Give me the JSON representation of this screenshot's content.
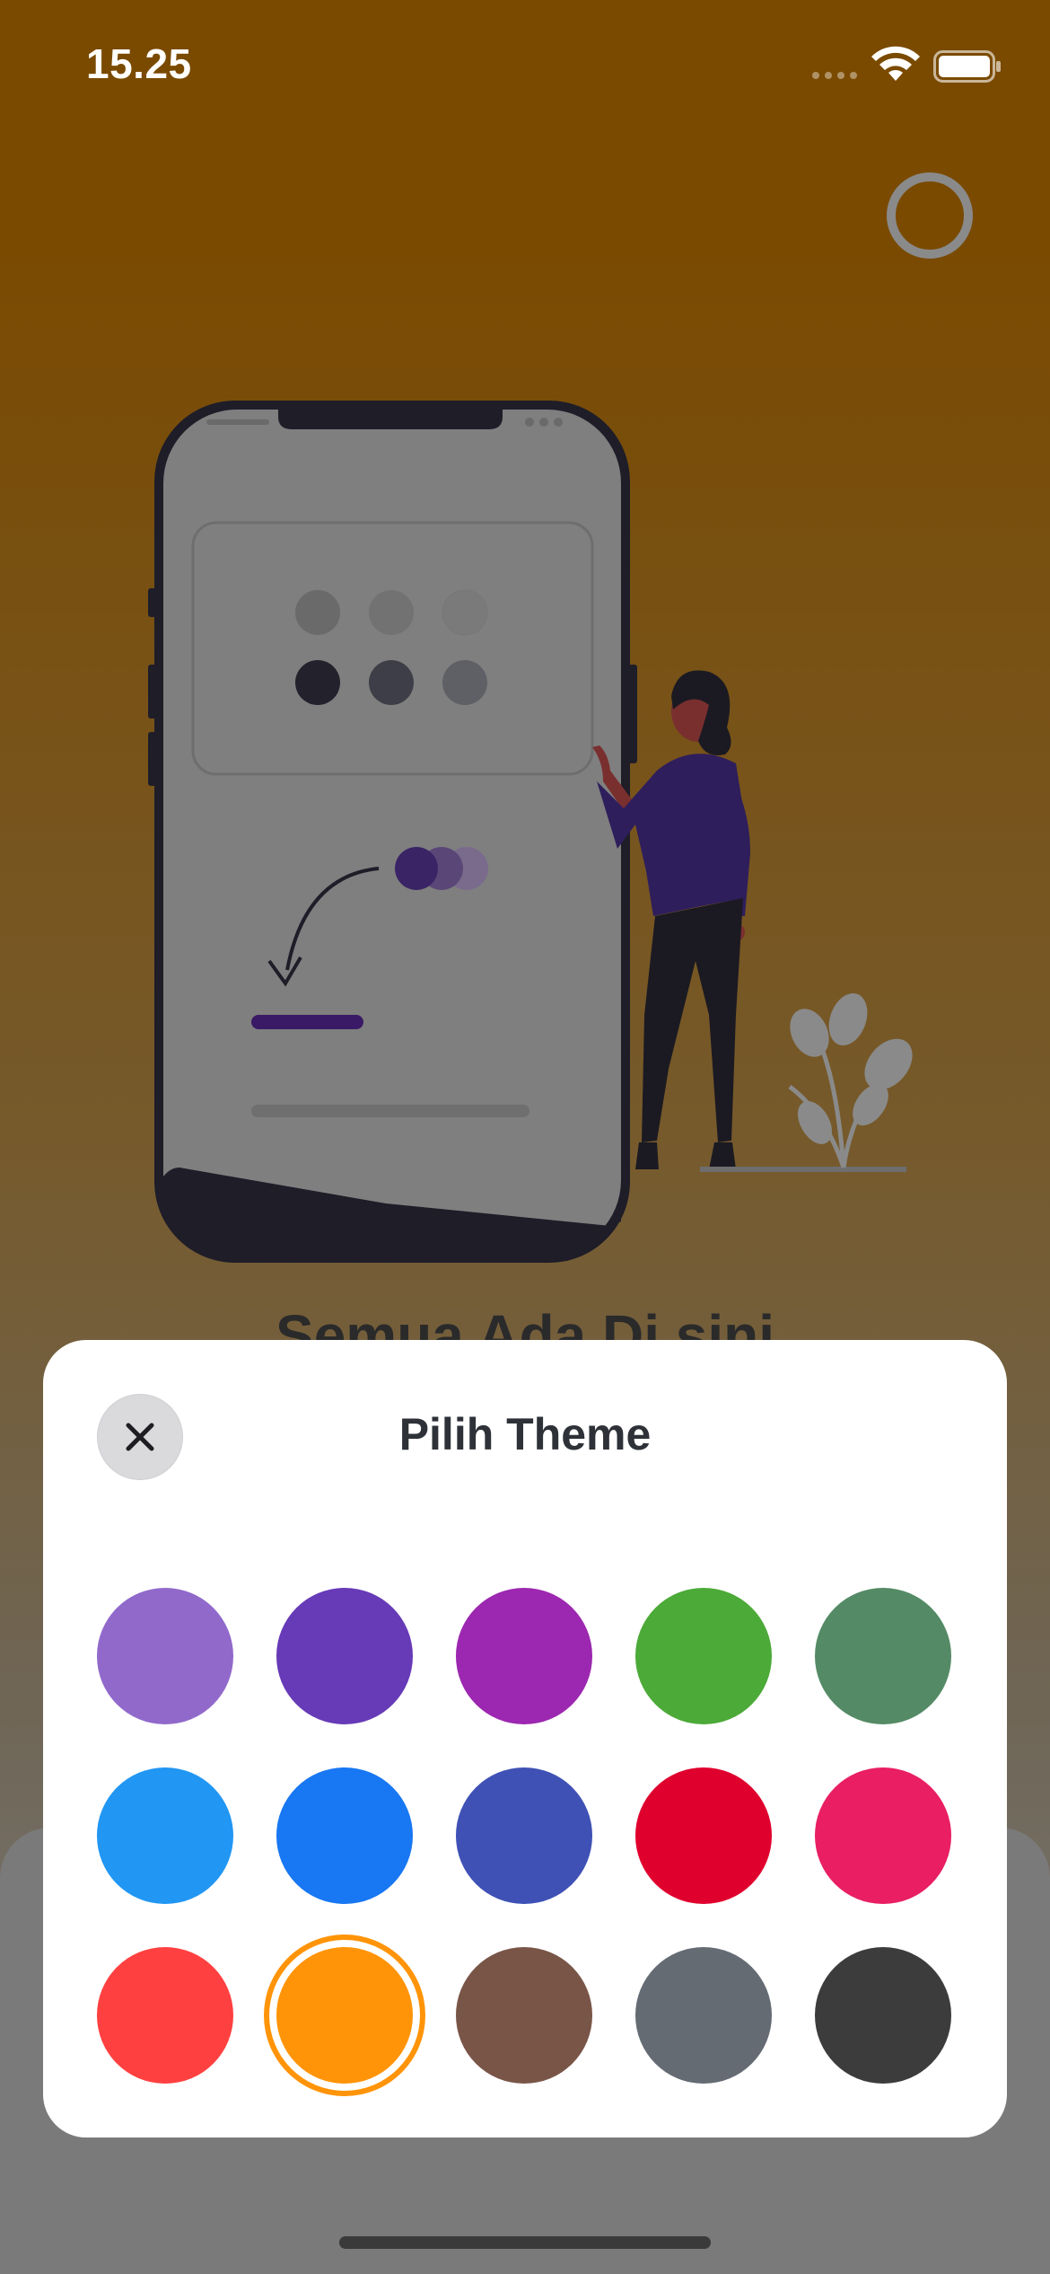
{
  "status_bar": {
    "time": "15.25",
    "icons": [
      "signal-icon",
      "wifi-icon",
      "battery-icon"
    ]
  },
  "background": {
    "title": "Semua Ada Di sini",
    "illustration": "phone-with-woman-illustration",
    "colors": {
      "top": "#7a4a00",
      "bottom": "#7a7a7a"
    }
  },
  "theme_modal": {
    "title": "Pilih Theme",
    "close_icon": "close-icon",
    "swatches": [
      {
        "color": "#9169cb",
        "selected": false
      },
      {
        "color": "#673ab7",
        "selected": false
      },
      {
        "color": "#9c27b0",
        "selected": false
      },
      {
        "color": "#4caa38",
        "selected": false
      },
      {
        "color": "#548a65",
        "selected": false
      },
      {
        "color": "#2196f3",
        "selected": false
      },
      {
        "color": "#1877f2",
        "selected": false
      },
      {
        "color": "#3f51b5",
        "selected": false
      },
      {
        "color": "#e0002e",
        "selected": false
      },
      {
        "color": "#e91e63",
        "selected": false
      },
      {
        "color": "#ff4040",
        "selected": false
      },
      {
        "color": "#ff9408",
        "selected": true
      },
      {
        "color": "#795548",
        "selected": false
      },
      {
        "color": "#646b73",
        "selected": false
      },
      {
        "color": "#3c3c3c",
        "selected": false
      }
    ]
  }
}
